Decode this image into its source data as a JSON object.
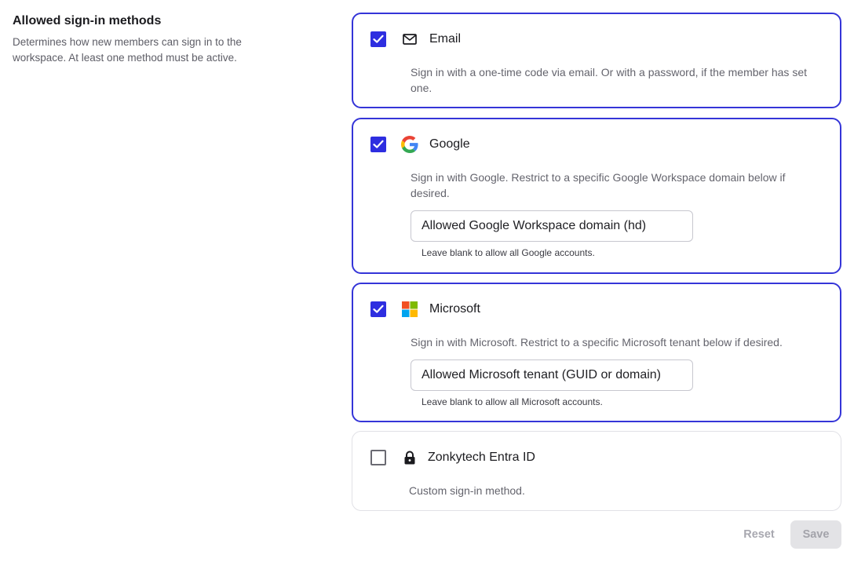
{
  "section": {
    "title": "Allowed sign-in methods",
    "description": "Determines how new members can sign in to the workspace. At least one method must be active."
  },
  "methods": [
    {
      "name": "Email",
      "icon": "mail-icon",
      "checked": true,
      "description": "Sign in with a one-time code via email. Or with a password, if the member has set one."
    },
    {
      "name": "Google",
      "icon": "google-logo-icon",
      "checked": true,
      "description": "Sign in with Google. Restrict to a specific Google Workspace domain below if desired.",
      "field_placeholder": "Allowed Google Workspace domain (hd)",
      "field_value": "",
      "hint": "Leave blank to allow all Google accounts."
    },
    {
      "name": "Microsoft",
      "icon": "microsoft-logo-icon",
      "checked": true,
      "description": "Sign in with Microsoft. Restrict to a specific Microsoft tenant below if desired.",
      "field_placeholder": "Allowed Microsoft tenant (GUID or domain)",
      "field_value": "",
      "hint": "Leave blank to allow all Microsoft accounts."
    },
    {
      "name": "Zonkytech Entra ID",
      "icon": "lock-icon",
      "checked": false,
      "description": "Custom sign-in method."
    }
  ],
  "actions": {
    "reset_label": "Reset",
    "save_label": "Save"
  },
  "colors": {
    "accent": "#3535d8",
    "checkbox_checked": "#2e2ee0",
    "muted_text": "#64646d"
  }
}
